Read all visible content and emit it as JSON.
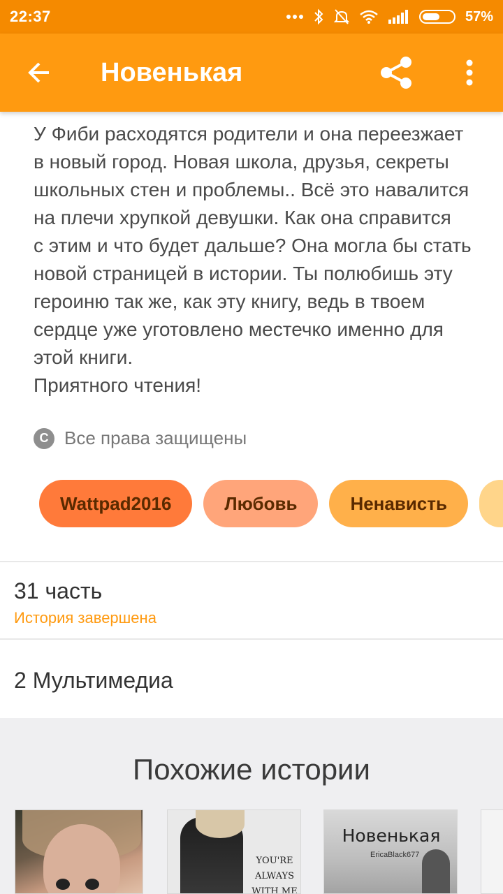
{
  "status_bar": {
    "time": "22:37",
    "battery_percent": "57%",
    "battery_level": 0.57,
    "icons": [
      "more-dots-icon",
      "bluetooth-icon",
      "mute-icon",
      "wifi-icon",
      "signal-icon",
      "battery-icon"
    ]
  },
  "app_bar": {
    "title": "Новенькая",
    "back_icon": "arrow-left-icon",
    "share_icon": "share-icon",
    "more_icon": "more-vert-icon"
  },
  "description": "У Фиби расходятся родители и она переезжает\nв новый город. Новая школа, друзья, секреты\nшкольных стен и проблемы.. Всё это навалится\nна плечи хрупкой девушки. Как она справится\nс этим и что будет дальше? Она могла бы стать\nновой страницей в истории. Ты полюбишь эту\nгероиню так же, как эту книгу, ведь в твоем\nсердце уже уготовлено местечко именно для\nэтой книги.\nПриятного чтения!",
  "copyright": {
    "icon": "copyright-icon",
    "icon_glyph": "C",
    "text": "Все права защищены"
  },
  "tags": [
    "Wattpad2016",
    "Любовь",
    "Ненависть"
  ],
  "parts": {
    "count_label": "31 часть",
    "status": "История завершена"
  },
  "media": {
    "label": "2 Мультимедиа"
  },
  "similar": {
    "title": "Похожие истории",
    "covers": [
      {
        "text": ""
      },
      {
        "text": "YOU'RE\nALWAYS\nWITH ME"
      },
      {
        "title": "Новенькая",
        "author": "EricaBlack677"
      },
      {
        "text": ""
      }
    ]
  },
  "colors": {
    "accent": "#ff9a10",
    "status_bar": "#f58a00",
    "tag_1": "#ff7a3a",
    "tag_2": "#ffa57a",
    "tag_3": "#ffb04a"
  }
}
